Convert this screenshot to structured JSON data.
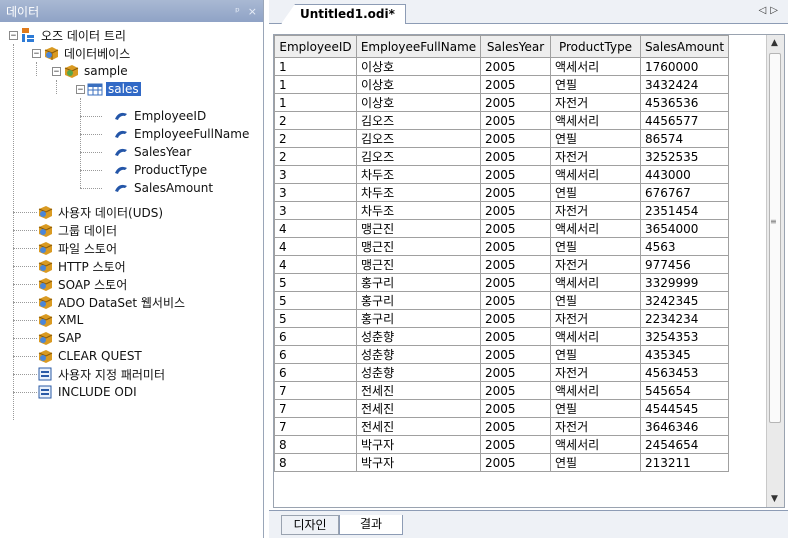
{
  "left_panel": {
    "title": "데이터",
    "pin_glyph": "ᵖ",
    "close_glyph": "×"
  },
  "tree": {
    "root": "오즈 데이터 트리",
    "database": "데이터베이스",
    "sample": "sample",
    "sales": "sales",
    "fields": [
      "EmployeeID",
      "EmployeeFullName",
      "SalesYear",
      "ProductType",
      "SalesAmount"
    ],
    "sources": [
      "사용자 데이터(UDS)",
      "그룹 데이터",
      "파일 스토어",
      "HTTP 스토어",
      "SOAP 스토어",
      "ADO DataSet 웹서비스",
      "XML",
      "SAP",
      "CLEAR QUEST"
    ],
    "params": [
      "사용자 지정 패러미터",
      "INCLUDE ODI"
    ]
  },
  "document": {
    "tab_title": "Untitled1.odi*",
    "nav_glyphs": "◁▷"
  },
  "grid": {
    "columns": [
      "EmployeeID",
      "EmployeeFullName",
      "SalesYear",
      "ProductType",
      "SalesAmount"
    ],
    "rows": [
      [
        "1",
        "이상호",
        "2005",
        "액세서리",
        "1760000"
      ],
      [
        "1",
        "이상호",
        "2005",
        "연필",
        "3432424"
      ],
      [
        "1",
        "이상호",
        "2005",
        "자전거",
        "4536536"
      ],
      [
        "2",
        "김오즈",
        "2005",
        "액세서리",
        "4456577"
      ],
      [
        "2",
        "김오즈",
        "2005",
        "연필",
        "86574"
      ],
      [
        "2",
        "김오즈",
        "2005",
        "자전거",
        "3252535"
      ],
      [
        "3",
        "차두조",
        "2005",
        "액세서리",
        "443000"
      ],
      [
        "3",
        "차두조",
        "2005",
        "연필",
        "676767"
      ],
      [
        "3",
        "차두조",
        "2005",
        "자전거",
        "2351454"
      ],
      [
        "4",
        "맹근진",
        "2005",
        "액세서리",
        "3654000"
      ],
      [
        "4",
        "맹근진",
        "2005",
        "연필",
        "4563"
      ],
      [
        "4",
        "맹근진",
        "2005",
        "자전거",
        "977456"
      ],
      [
        "5",
        "홍구리",
        "2005",
        "액세서리",
        "3329999"
      ],
      [
        "5",
        "홍구리",
        "2005",
        "연필",
        "3242345"
      ],
      [
        "5",
        "홍구리",
        "2005",
        "자전거",
        "2234234"
      ],
      [
        "6",
        "성춘향",
        "2005",
        "액세서리",
        "3254353"
      ],
      [
        "6",
        "성춘향",
        "2005",
        "연필",
        "435345"
      ],
      [
        "6",
        "성춘향",
        "2005",
        "자전거",
        "4563453"
      ],
      [
        "7",
        "전세진",
        "2005",
        "액세서리",
        "545654"
      ],
      [
        "7",
        "전세진",
        "2005",
        "연필",
        "4544545"
      ],
      [
        "7",
        "전세진",
        "2005",
        "자전거",
        "3646346"
      ],
      [
        "8",
        "박구자",
        "2005",
        "액세서리",
        "2454654"
      ],
      [
        "8",
        "박구자",
        "2005",
        "연필",
        "213211"
      ]
    ]
  },
  "bottom_tabs": {
    "design": "디자인",
    "result": "결과"
  }
}
